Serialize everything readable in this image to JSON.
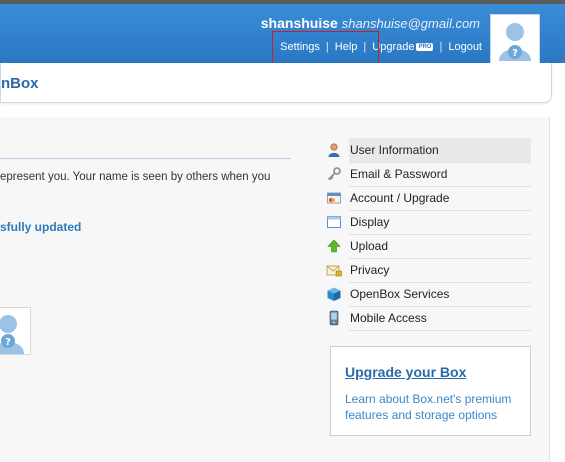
{
  "header": {
    "username": "shanshuise",
    "email": "shanshuise@gmail.com",
    "nav": {
      "settings": "Settings",
      "help": "Help",
      "upgrade": "Upgrade",
      "pro_badge": "PRO",
      "logout": "Logout",
      "separator": "|"
    }
  },
  "page": {
    "title": "nBox",
    "intro_text": "epresent you. Your name is seen by others when you",
    "success_message": "sfully updated"
  },
  "side_menu": {
    "items": [
      {
        "label": "User Information",
        "icon": "user-icon",
        "active": true
      },
      {
        "label": "Email & Password",
        "icon": "key-icon",
        "active": false
      },
      {
        "label": "Account / Upgrade",
        "icon": "account-card-icon",
        "active": false
      },
      {
        "label": "Display",
        "icon": "window-icon",
        "active": false
      },
      {
        "label": "Upload",
        "icon": "upload-arrow-icon",
        "active": false
      },
      {
        "label": "Privacy",
        "icon": "envelope-lock-icon",
        "active": false
      },
      {
        "label": "OpenBox Services",
        "icon": "box-icon",
        "active": false
      },
      {
        "label": "Mobile Access",
        "icon": "mobile-phone-icon",
        "active": false
      }
    ]
  },
  "upgrade_box": {
    "title": "Upgrade your Box",
    "description": "Learn about Box.net's premium features and storage options"
  },
  "colors": {
    "header_blue": "#2a78c4",
    "link_blue": "#2a6aa8",
    "highlight_red": "#c8202a",
    "success_blue": "#2c7bbd"
  }
}
